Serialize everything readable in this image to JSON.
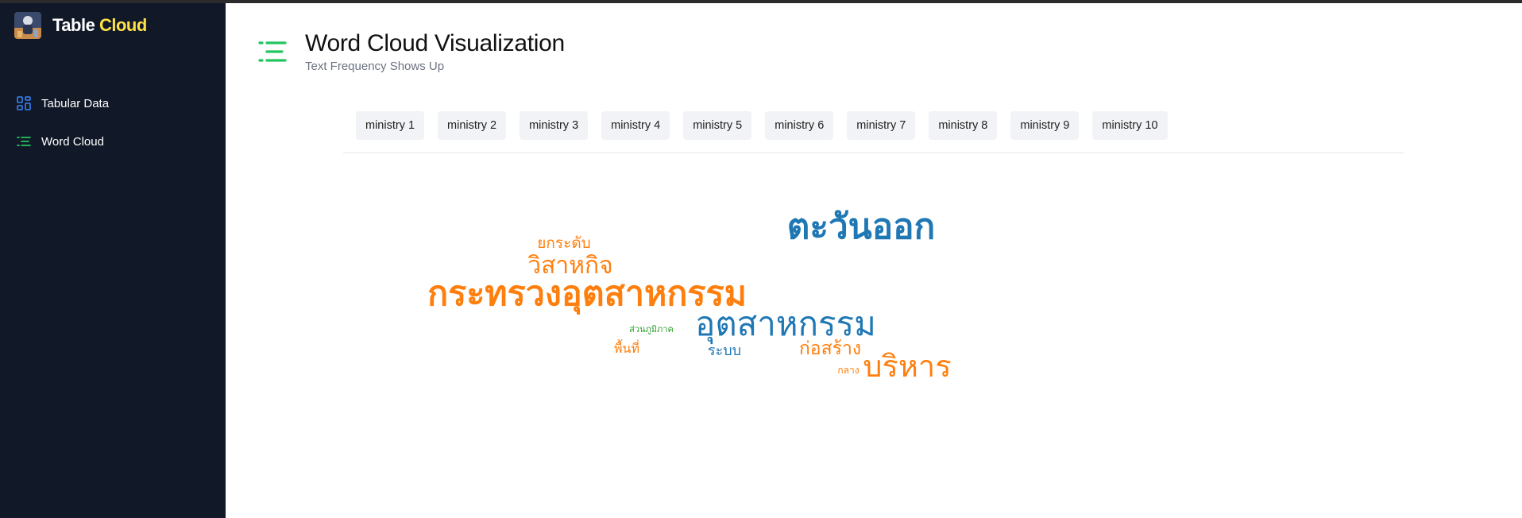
{
  "app": {
    "brand_main": "Table",
    "brand_accent": "Cloud"
  },
  "sidebar": {
    "items": [
      {
        "label": "Tabular Data",
        "icon": "grid-icon"
      },
      {
        "label": "Word Cloud",
        "icon": "list-icon"
      }
    ]
  },
  "header": {
    "title": "Word Cloud Visualization",
    "subtitle": "Text Frequency Shows Up",
    "icon": "list-icon"
  },
  "tabs": [
    "ministry 1",
    "ministry 2",
    "ministry 3",
    "ministry 4",
    "ministry 5",
    "ministry 6",
    "ministry 7",
    "ministry 8",
    "ministry 9",
    "ministry 10"
  ],
  "colors": {
    "sidebar_bg": "#111827",
    "brand_accent": "#fde047",
    "orange": "#ff7f0e",
    "blue": "#1f77b4",
    "green": "#2ca02c",
    "icon_blue": "#3b82f6",
    "icon_green": "#22c55e"
  },
  "word_cloud": {
    "words": [
      {
        "text": "ตะวันออก",
        "color": "#1f77b4"
      },
      {
        "text": "ยกระดับ",
        "color": "#ff7f0e"
      },
      {
        "text": "วิสาหกิจ",
        "color": "#ff7f0e"
      },
      {
        "text": "กระทรวงอุตสาหกรรม",
        "color": "#ff7f0e"
      },
      {
        "text": "อุตสาหกรรม",
        "color": "#1f77b4"
      },
      {
        "text": "ส่วนภูมิภาค",
        "color": "#2ca02c"
      },
      {
        "text": "พื้นที่",
        "color": "#ff7f0e"
      },
      {
        "text": "ระบบ",
        "color": "#1f77b4"
      },
      {
        "text": "ก่อสร้าง",
        "color": "#ff7f0e"
      },
      {
        "text": "กลาง",
        "color": "#ff7f0e"
      },
      {
        "text": "บริหาร",
        "color": "#ff7f0e"
      }
    ]
  }
}
